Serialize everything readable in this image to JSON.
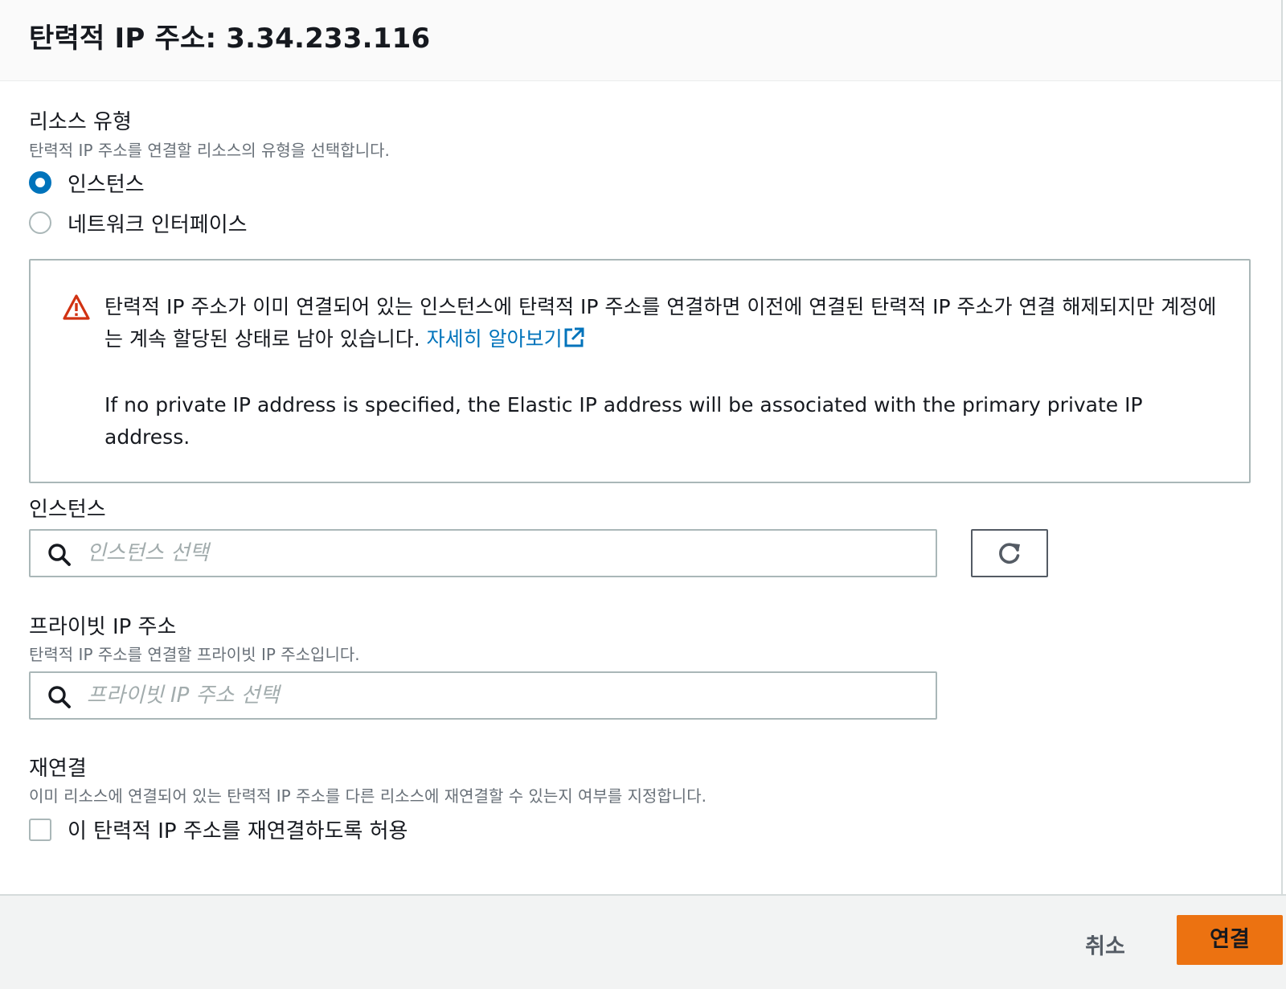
{
  "header": {
    "title": "탄력적 IP 주소: 3.34.233.116"
  },
  "resource_type": {
    "label": "리소스 유형",
    "description": "탄력적 IP 주소를 연결할 리소스의 유형을 선택합니다.",
    "options": [
      {
        "label": "인스턴스",
        "checked": true
      },
      {
        "label": "네트워크 인터페이스",
        "checked": false
      }
    ]
  },
  "alert": {
    "text": "탄력적 IP 주소가 이미 연결되어 있는 인스턴스에 탄력적 IP 주소를 연결하면 이전에 연결된 탄력적 IP 주소가 연결 해제되지만 계정에는 계속 할당된 상태로 남아 있습니다. ",
    "link_label": "자세히 알아보기",
    "text2": "If no private IP address is specified, the Elastic IP address will be associated with the primary private IP address.",
    "icon": "warning-icon",
    "icon_color": "#d13212"
  },
  "instance": {
    "label": "인스턴스",
    "placeholder": "인스턴스 선택",
    "refresh_icon": "refresh-icon"
  },
  "private_ip": {
    "label": "프라이빗 IP 주소",
    "description": "탄력적 IP 주소를 연결할 프라이빗 IP 주소입니다.",
    "placeholder": "프라이빗 IP 주소 선택"
  },
  "reassociation": {
    "label": "재연결",
    "description": "이미 리소스에 연결되어 있는 탄력적 IP 주소를 다른 리소스에 재연결할 수 있는지 여부를 지정합니다.",
    "checkbox_label": "이 탄력적 IP 주소를 재연결하도록 허용",
    "checked": false
  },
  "footer": {
    "cancel_label": "취소",
    "primary_label": "연결",
    "primary_color": "#ec7211"
  }
}
